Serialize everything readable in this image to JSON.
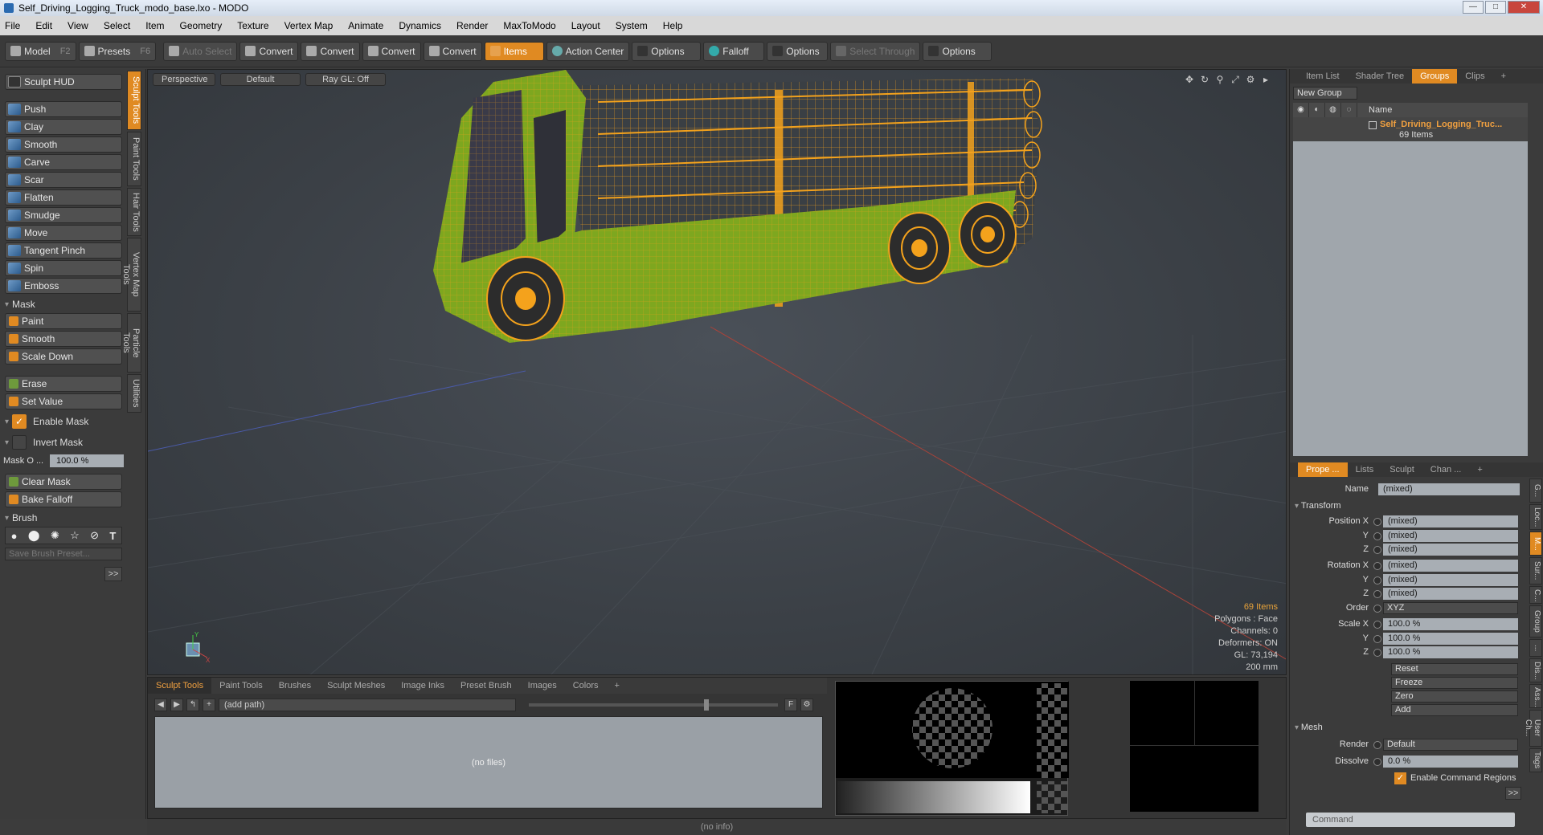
{
  "window": {
    "title": "Self_Driving_Logging_Truck_modo_base.lxo - MODO"
  },
  "menu": [
    "File",
    "Edit",
    "View",
    "Select",
    "Item",
    "Geometry",
    "Texture",
    "Vertex Map",
    "Animate",
    "Dynamics",
    "Render",
    "MaxToModo",
    "Layout",
    "System",
    "Help"
  ],
  "toolbar": {
    "model": "Model",
    "model_key": "F2",
    "presets": "Presets",
    "presets_key": "F6",
    "auto_select": "Auto Select",
    "convert1": "Convert",
    "convert2": "Convert",
    "convert3": "Convert",
    "convert4": "Convert",
    "items": "Items",
    "action_center": "Action Center",
    "options1": "Options",
    "falloff": "Falloff",
    "options2": "Options",
    "select_through": "Select Through",
    "options3": "Options"
  },
  "left": {
    "sculpt_hud": "Sculpt HUD",
    "tools": [
      "Push",
      "Clay",
      "Smooth",
      "Carve",
      "Scar",
      "Flatten",
      "Smudge",
      "Move",
      "Tangent Pinch",
      "Spin",
      "Emboss"
    ],
    "mask_header": "Mask",
    "mask_tools": [
      "Paint",
      "Smooth",
      "Scale Down"
    ],
    "erase": "Erase",
    "set_value": "Set Value",
    "enable_mask": "Enable Mask",
    "invert_mask": "Invert Mask",
    "mask_opacity_label": "Mask O ...",
    "mask_opacity_value": "100.0 %",
    "clear_mask": "Clear Mask",
    "bake_falloff": "Bake Falloff",
    "brush_header": "Brush",
    "save_brush_preset": "Save Brush Preset...",
    "more": ">>"
  },
  "vtabs": [
    "Sculpt Tools",
    "Paint Tools",
    "Hair Tools",
    "Vertex Map Tools",
    "Particle Tools",
    "Utilities"
  ],
  "viewport": {
    "view": "Perspective",
    "shading": "Default",
    "raygl": "Ray GL: Off",
    "info": {
      "items": "69 Items",
      "polygons": "Polygons : Face",
      "channels": "Channels: 0",
      "deformers": "Deformers: ON",
      "gl": "GL: 73,194",
      "scale": "200 mm"
    }
  },
  "bottom": {
    "tabs": [
      "Sculpt Tools",
      "Paint Tools",
      "Brushes",
      "Sculpt Meshes",
      "Image Inks",
      "Preset Brush",
      "Images",
      "Colors",
      "+"
    ],
    "path": "(add path)",
    "no_files": "(no files)",
    "status": "(no info)"
  },
  "right": {
    "tabs": [
      "Item List",
      "Shader Tree",
      "Groups",
      "Clips",
      "+"
    ],
    "new_group": "New Group",
    "name_header": "Name",
    "group_name": "Self_Driving_Logging_Truc...",
    "group_count": "69 Items",
    "prop_tabs": [
      "Prope ...",
      "Lists",
      "Sculpt",
      "Chan ...",
      "+"
    ],
    "name_label": "Name",
    "name_value": "(mixed)",
    "transform": "Transform",
    "position_label": "Position X",
    "rotation_label": "Rotation X",
    "y": "Y",
    "z": "Z",
    "mixed": "(mixed)",
    "order_label": "Order",
    "order_value": "XYZ",
    "scale_label": "Scale X",
    "scale_value": "100.0 %",
    "reset": "Reset",
    "freeze": "Freeze",
    "zero": "Zero",
    "add": "Add",
    "mesh": "Mesh",
    "render_label": "Render",
    "render_value": "Default",
    "dissolve_label": "Dissolve",
    "dissolve_value": "0.0 %",
    "enable_cmd_regions": "Enable Command Regions",
    "more": ">>",
    "command_placeholder": "Command"
  },
  "side_vtabs": [
    "G...",
    "Loc...",
    "M...",
    "Sur...",
    "C...",
    "Group",
    "...",
    "Dis...",
    "Ass...",
    "User Ch...",
    "Tags"
  ]
}
